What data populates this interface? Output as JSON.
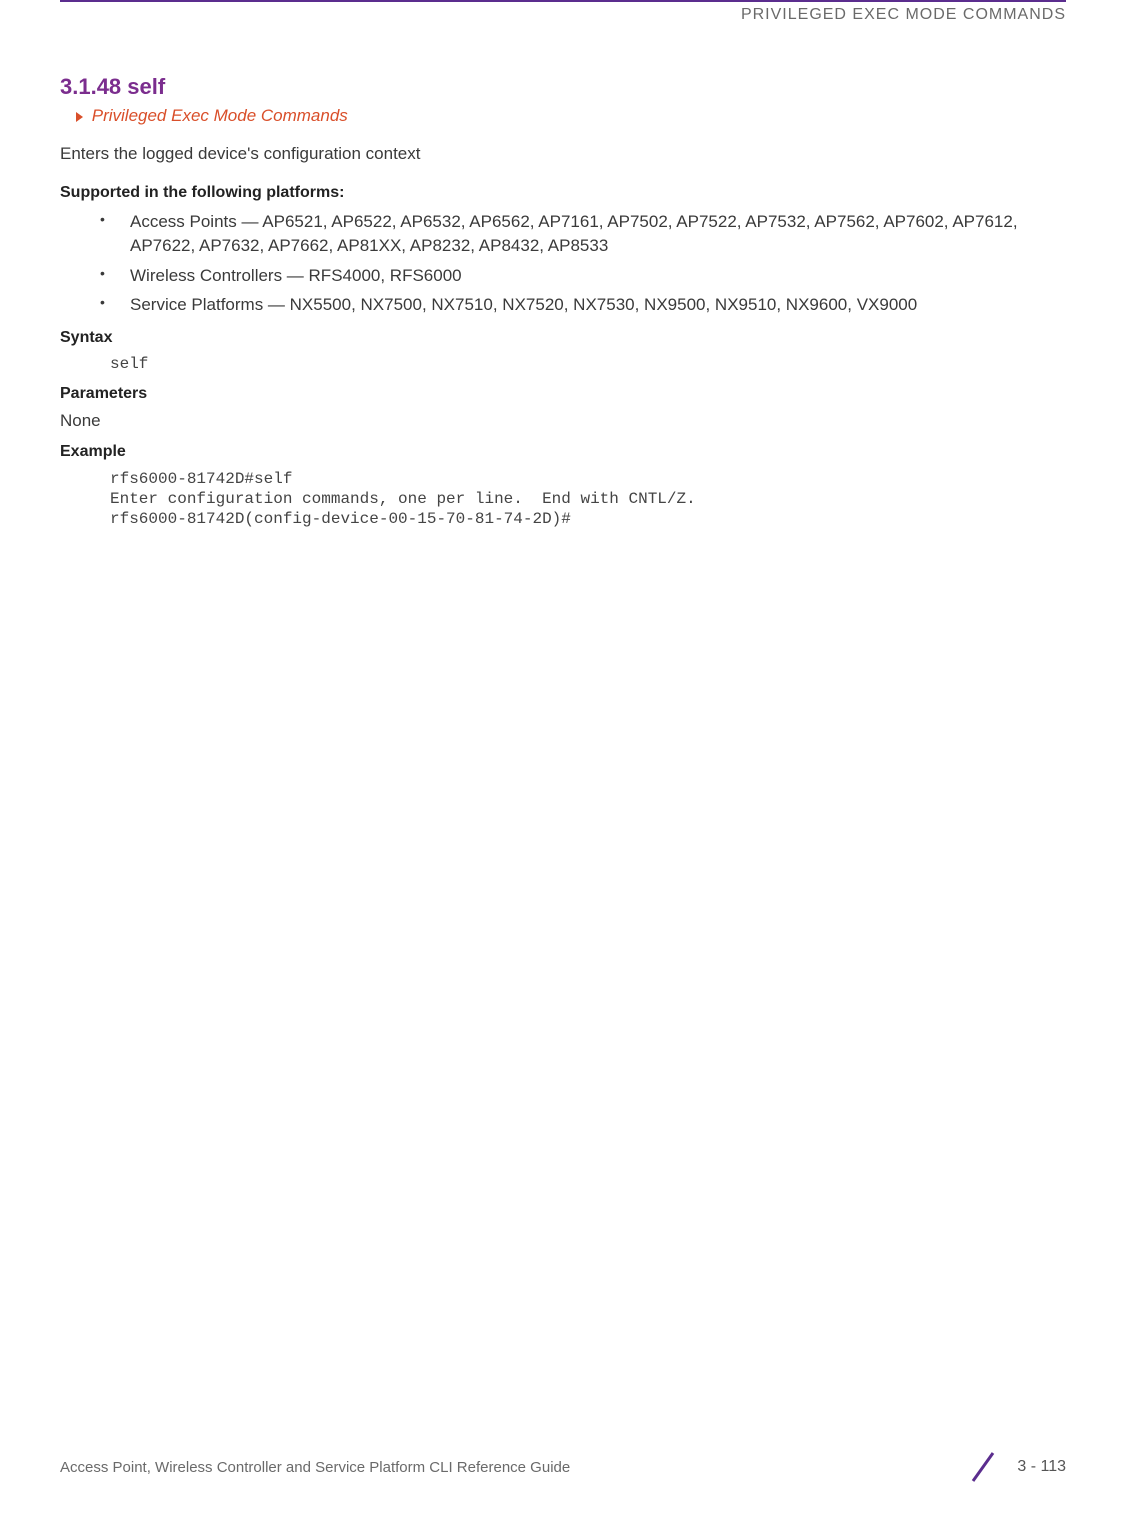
{
  "header": {
    "chapter_title": "PRIVILEGED EXEC MODE COMMANDS"
  },
  "section": {
    "number_title": "3.1.48 self",
    "breadcrumb": "Privileged Exec Mode Commands",
    "description": "Enters the logged device's configuration context"
  },
  "supported": {
    "heading": "Supported in the following platforms:",
    "items": [
      "Access Points — AP6521, AP6522, AP6532, AP6562, AP7161, AP7502, AP7522, AP7532, AP7562, AP7602, AP7612, AP7622, AP7632, AP7662, AP81XX, AP8232, AP8432, AP8533",
      "Wireless Controllers — RFS4000, RFS6000",
      "Service Platforms — NX5500, NX7500, NX7510, NX7520, NX7530, NX9500, NX9510, NX9600, VX9000"
    ]
  },
  "syntax": {
    "heading": "Syntax",
    "code": "self"
  },
  "parameters": {
    "heading": "Parameters",
    "text": "None"
  },
  "example": {
    "heading": "Example",
    "code": "rfs6000-81742D#self\nEnter configuration commands, one per line.  End with CNTL/Z.\nrfs6000-81742D(config-device-00-15-70-81-74-2D)#"
  },
  "footer": {
    "doc_title": "Access Point, Wireless Controller and Service Platform CLI Reference Guide",
    "page_number": "3 - 113"
  }
}
